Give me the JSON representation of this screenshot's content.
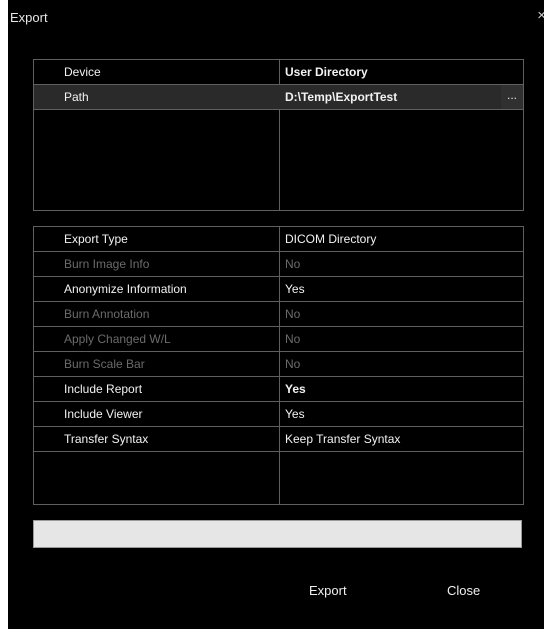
{
  "window": {
    "title": "Export",
    "close_glyph": "×"
  },
  "device_table": {
    "rows": [
      {
        "label": "Device",
        "value": "User Directory",
        "enabled": true,
        "bold": true
      },
      {
        "label": "Path",
        "value": "D:\\Temp\\ExportTest",
        "enabled": true,
        "bold": true,
        "selected": true,
        "browse_label": "..."
      }
    ]
  },
  "options_table": {
    "rows": [
      {
        "label": "Export Type",
        "value": "DICOM Directory",
        "enabled": true
      },
      {
        "label": "Burn Image Info",
        "value": "No",
        "enabled": false
      },
      {
        "label": "Anonymize Information",
        "value": "Yes",
        "enabled": true
      },
      {
        "label": "Burn Annotation",
        "value": "No",
        "enabled": false
      },
      {
        "label": "Apply Changed W/L",
        "value": "No",
        "enabled": false
      },
      {
        "label": "Burn Scale Bar",
        "value": "No",
        "enabled": false
      },
      {
        "label": "Include Report",
        "value": "Yes",
        "enabled": true,
        "value_bold": true
      },
      {
        "label": "Include Viewer",
        "value": "Yes",
        "enabled": true
      },
      {
        "label": "Transfer Syntax",
        "value": "Keep Transfer Syntax",
        "enabled": true
      }
    ]
  },
  "progress": {
    "fraction": 0
  },
  "buttons": {
    "export_label": "Export",
    "close_label": "Close"
  },
  "colors": {
    "background": "#000000",
    "grid_line": "#5f5f5f",
    "text_enabled": "#f2f2f2",
    "text_disabled": "#6b6b6b",
    "selected_row": "#2a2a2a",
    "progress_track": "#e6e6e6"
  }
}
